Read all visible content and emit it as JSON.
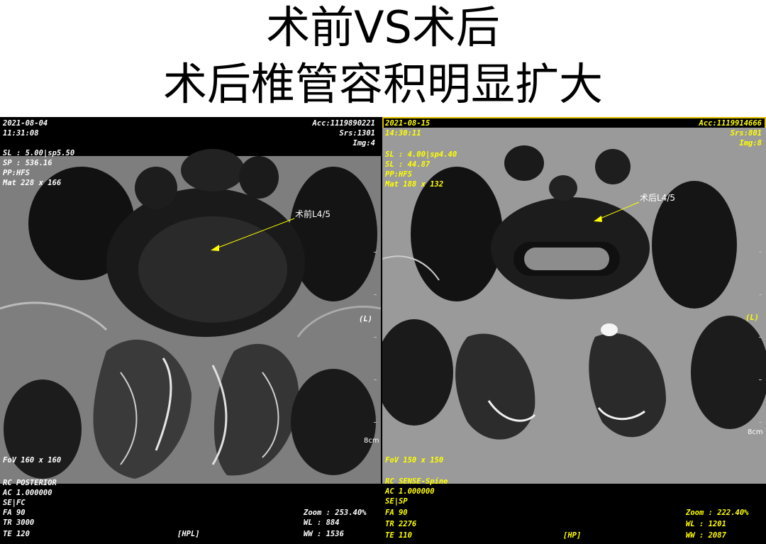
{
  "title": {
    "line1": "术前VS术后",
    "line2": "术后椎管容积明显扩大"
  },
  "left_panel": {
    "date": "2021-08-04",
    "time": "11:31:08",
    "acc": "Acc:1119890221",
    "srs": "Srs:1301",
    "img": "Img:4",
    "sl": "SL : 5.00|sp5.50",
    "sp": "SP : 536.16",
    "pp": "PP:HFS",
    "mat": "Mat 228 x 166",
    "orient": "(L)",
    "scale": "8cm",
    "fov": "FoV 160 x 160",
    "annotation": "术前L4/5",
    "bottom_left": [
      "RC POSTERIOR",
      "AC 1.000000",
      "SE|FC",
      "FA 90",
      "TR 3000",
      "TE 120"
    ],
    "bottom_center": "[HPL]",
    "zoom": "Zoom : 253.40%",
    "wl": "WL : 884",
    "ww": "WW : 1536"
  },
  "right_panel": {
    "date": "2021-08-15",
    "time": "14:30:11",
    "acc": "Acc:1119914666",
    "srs": "Srs:801",
    "img": "Img:8",
    "sl": "SL : 4.00|sp4.40",
    "sp": "SL : 44.87",
    "pp": "PP:HFS",
    "mat": "Mat 188 x 132",
    "orient": "(L)",
    "scale": "8cm",
    "fov": "FoV 150 x 150",
    "annotation": "术后L4/5",
    "bottom_left": [
      "RC SENSE-Spine",
      "AC 1.000000",
      "SE|SP",
      "FA 90",
      "TR 2276",
      "TE 110"
    ],
    "bottom_center": "[HP]",
    "zoom": "Zoom : 222.40%",
    "wl": "WL : 1201",
    "ww": "WW : 2087"
  },
  "colors": {
    "left_overlay": "#ffffff",
    "right_overlay": "#ffff00",
    "annotation_arrow": "#ffff00",
    "right_border": "#e3c000"
  }
}
